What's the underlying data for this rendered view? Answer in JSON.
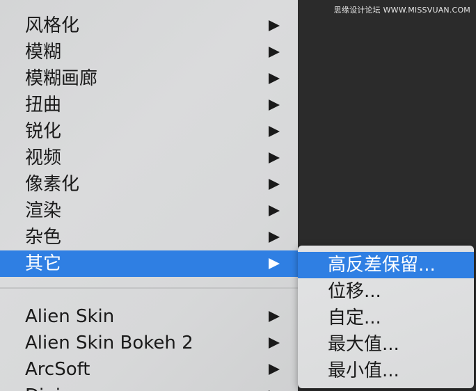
{
  "watermark": "思缘设计论坛 WWW.MISSVUAN.COM",
  "filter_menu": {
    "items": [
      {
        "label": "风格化"
      },
      {
        "label": "模糊"
      },
      {
        "label": "模糊画廊"
      },
      {
        "label": "扭曲"
      },
      {
        "label": "锐化"
      },
      {
        "label": "视频"
      },
      {
        "label": "像素化"
      },
      {
        "label": "渲染"
      },
      {
        "label": "杂色"
      },
      {
        "label": "其它",
        "selected": true
      }
    ],
    "plugins": [
      {
        "label": "Alien Skin"
      },
      {
        "label": "Alien Skin Bokeh 2"
      },
      {
        "label": "ArcSoft"
      },
      {
        "label": "Digimarc"
      }
    ],
    "submenu_arrow_icon": "triangle-right-icon"
  },
  "other_submenu": {
    "items": [
      {
        "label": "高反差保留...",
        "selected": true
      },
      {
        "label": "位移..."
      },
      {
        "label": "自定..."
      },
      {
        "label": "最大值..."
      },
      {
        "label": "最小值..."
      }
    ]
  },
  "colors": {
    "selection": "#2f7fe3",
    "menu_background": "#d8d9da",
    "canvas_background": "#2b2b2b"
  }
}
